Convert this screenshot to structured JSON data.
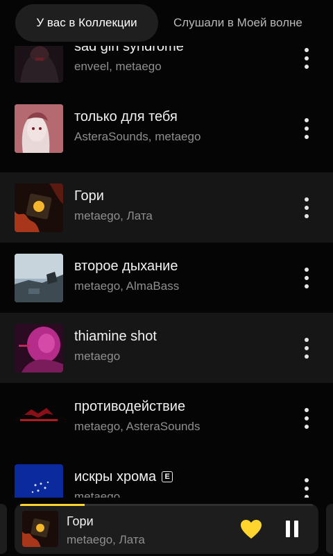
{
  "tabs": {
    "active_label": "У вас в Коллекции",
    "other_label": "Слушали в Моей волне"
  },
  "tracks": [
    {
      "title": "sad girl syndrome",
      "artist": "enveel, metaego"
    },
    {
      "title": "только для тебя",
      "artist": "AsteraSounds, metaego"
    },
    {
      "title": "Гори",
      "artist": "metaego, Лата"
    },
    {
      "title": "второе дыхание",
      "artist": "metaego, AlmaBass"
    },
    {
      "title": "thiamine shot",
      "artist": "metaego"
    },
    {
      "title": "противодействие",
      "artist": "metaego, AsteraSounds"
    },
    {
      "title": "искры хрома",
      "artist": "metaego",
      "explicit_badge": "E"
    }
  ],
  "now_playing": {
    "title": "Гори",
    "artist": "metaego, Лата",
    "progress_fraction": 0.22,
    "liked": true,
    "state": "playing"
  },
  "icons": {
    "more": "more-vertical-icon",
    "like": "heart-icon",
    "pause": "pause-icon"
  },
  "colors": {
    "accent": "#ffd42e",
    "background": "#050505",
    "highlight_row": "#161616",
    "player_bg": "#1d1d1d"
  }
}
